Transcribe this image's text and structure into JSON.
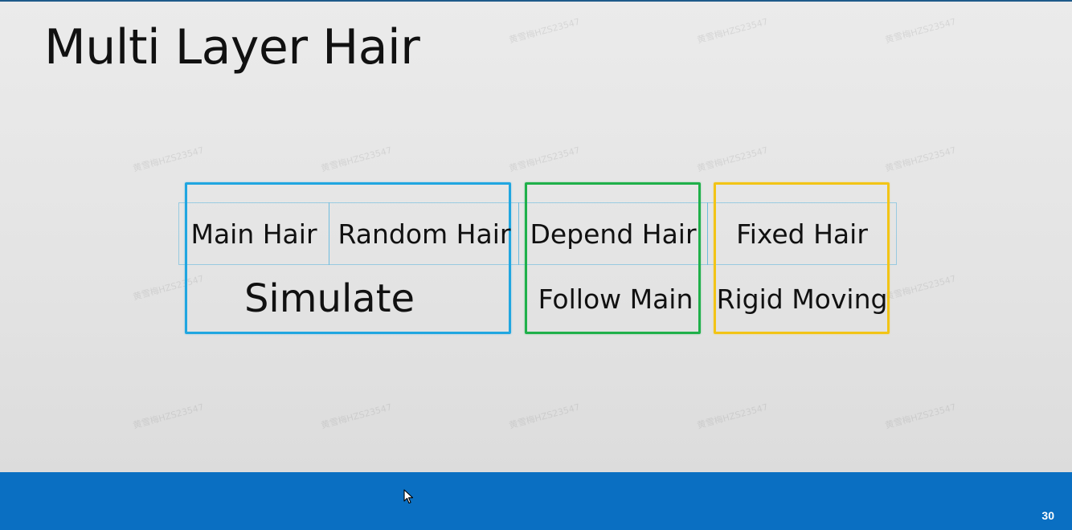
{
  "slide": {
    "title": "Multi Layer Hair",
    "page_number": "30"
  },
  "diagram": {
    "cells": [
      {
        "label": "Main Hair"
      },
      {
        "label": "Random Hair"
      },
      {
        "label": "Depend Hair"
      },
      {
        "label": "Fixed Hair"
      }
    ],
    "groups": [
      {
        "label": "Simulate",
        "color": "#20a6e0"
      },
      {
        "label": "Follow Main",
        "color": "#1fb04a"
      },
      {
        "label": "Rigid Moving",
        "color": "#f2c416"
      }
    ]
  },
  "colors": {
    "footer": "#0a6fc2",
    "background": "#e6e6e6"
  },
  "watermark": {
    "text": "黄雪梅HZS23547"
  }
}
